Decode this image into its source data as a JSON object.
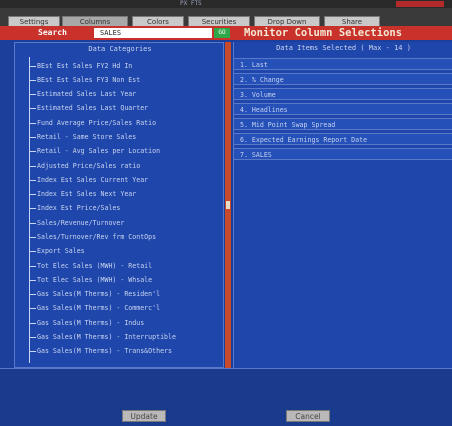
{
  "window": {
    "title": "PX FTS"
  },
  "tabs": [
    "Settings",
    "Columns",
    "Colors",
    "Securities",
    "Drop Down",
    "Share"
  ],
  "search": {
    "label": "Search",
    "value": "SALES",
    "go_label": "GO"
  },
  "page_title": "Monitor Column Selections",
  "left_panel": {
    "header": "Data Categories",
    "items": [
      "BEst Est Sales FY2 Hd In",
      "BEst Est Sales FY3 Non Est",
      "Estimated Sales Last Year",
      "Estimated Sales Last Quarter",
      "Fund Average Price/Sales Ratio",
      "Retail - Same Store Sales",
      "Retail - Avg Sales per Location",
      "Adjusted Price/Sales ratio",
      "Index Est Sales Current Year",
      "Index Est Sales Next Year",
      "Index Est Price/Sales",
      "Sales/Revenue/Turnover",
      "Sales/Turnover/Rev frm ContOps",
      "Export Sales",
      "Tot Elec Sales (MWH) - Retail",
      "Tot Elec Sales (MWH) - Whsale",
      "Gas Sales(M Therms) - Residen'l",
      "Gas Sales(M Therms) - Commerc'l",
      "Gas Sales(M Therms) - Indus",
      "Gas Sales(M Therms) - Interruptible",
      "Gas Sales(M Therms) - Trans&Others"
    ]
  },
  "right_panel": {
    "header": "Data Items Selected ( Max - 14 )",
    "items": [
      "1. Last",
      "2. % Change",
      "3. Volume",
      "4. Headlines",
      "5. Mid Point Swap Spread",
      "6. Expected Earnings Report Date",
      "7. SALES"
    ]
  },
  "footer": {
    "update_label": "Update",
    "cancel_label": "Cancel"
  },
  "colors": {
    "accent": "#c8322a",
    "panel": "#1f46aa",
    "go": "#2fa84a"
  }
}
